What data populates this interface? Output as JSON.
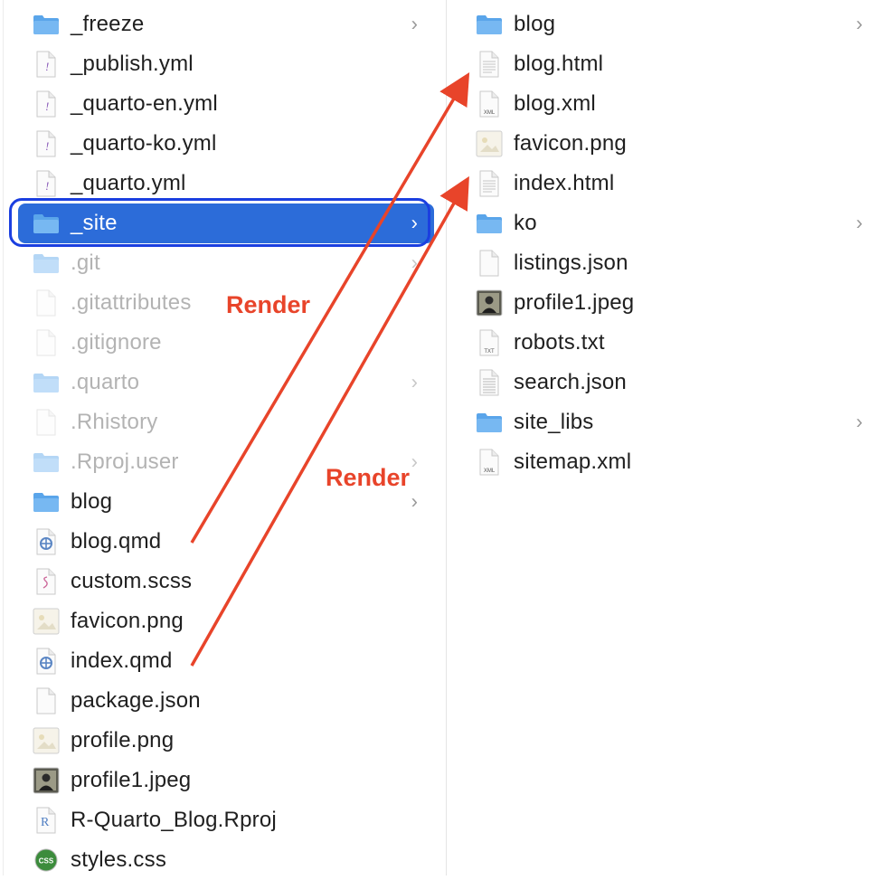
{
  "left_column": {
    "items": [
      {
        "label": "_freeze",
        "icon": "folder-icon",
        "chevron": true,
        "dim": false
      },
      {
        "label": "_publish.yml",
        "icon": "yaml-file-icon",
        "chevron": false,
        "dim": false
      },
      {
        "label": "_quarto-en.yml",
        "icon": "yaml-file-icon",
        "chevron": false,
        "dim": false
      },
      {
        "label": "_quarto-ko.yml",
        "icon": "yaml-file-icon",
        "chevron": false,
        "dim": false
      },
      {
        "label": "_quarto.yml",
        "icon": "yaml-file-icon",
        "chevron": false,
        "dim": false
      },
      {
        "label": "_site",
        "icon": "folder-icon",
        "chevron": true,
        "dim": false,
        "selected": true
      },
      {
        "label": ".git",
        "icon": "folder-icon",
        "chevron": true,
        "dim": true
      },
      {
        "label": ".gitattributes",
        "icon": "blank-file-icon",
        "chevron": false,
        "dim": true
      },
      {
        "label": ".gitignore",
        "icon": "blank-file-icon",
        "chevron": false,
        "dim": true
      },
      {
        "label": ".quarto",
        "icon": "folder-icon",
        "chevron": true,
        "dim": true
      },
      {
        "label": ".Rhistory",
        "icon": "blank-file-icon",
        "chevron": false,
        "dim": true
      },
      {
        "label": ".Rproj.user",
        "icon": "folder-icon",
        "chevron": true,
        "dim": true
      },
      {
        "label": "blog",
        "icon": "folder-icon",
        "chevron": true,
        "dim": false
      },
      {
        "label": "blog.qmd",
        "icon": "quarto-file-icon",
        "chevron": false,
        "dim": false
      },
      {
        "label": "custom.scss",
        "icon": "scss-file-icon",
        "chevron": false,
        "dim": false
      },
      {
        "label": "favicon.png",
        "icon": "image-file-icon",
        "chevron": false,
        "dim": false
      },
      {
        "label": "index.qmd",
        "icon": "quarto-file-icon",
        "chevron": false,
        "dim": false
      },
      {
        "label": "package.json",
        "icon": "blank-file-icon",
        "chevron": false,
        "dim": false
      },
      {
        "label": "profile.png",
        "icon": "image-file-icon",
        "chevron": false,
        "dim": false
      },
      {
        "label": "profile1.jpeg",
        "icon": "photo-file-icon",
        "chevron": false,
        "dim": false
      },
      {
        "label": "R-Quarto_Blog.Rproj",
        "icon": "rproj-file-icon",
        "chevron": false,
        "dim": false
      },
      {
        "label": "styles.css",
        "icon": "css-file-icon",
        "chevron": false,
        "dim": false
      }
    ]
  },
  "right_column": {
    "items": [
      {
        "label": "blog",
        "icon": "folder-icon",
        "chevron": true
      },
      {
        "label": "blog.html",
        "icon": "html-file-icon",
        "chevron": false
      },
      {
        "label": "blog.xml",
        "icon": "xml-file-icon",
        "chevron": false
      },
      {
        "label": "favicon.png",
        "icon": "image-file-icon",
        "chevron": false
      },
      {
        "label": "index.html",
        "icon": "html-file-icon",
        "chevron": false
      },
      {
        "label": "ko",
        "icon": "folder-icon",
        "chevron": true
      },
      {
        "label": "listings.json",
        "icon": "blank-file-icon",
        "chevron": false
      },
      {
        "label": "profile1.jpeg",
        "icon": "photo-file-icon",
        "chevron": false
      },
      {
        "label": "robots.txt",
        "icon": "txt-file-icon",
        "chevron": false
      },
      {
        "label": "search.json",
        "icon": "text-file-icon",
        "chevron": false
      },
      {
        "label": "site_libs",
        "icon": "folder-icon",
        "chevron": true
      },
      {
        "label": "sitemap.xml",
        "icon": "xml-file-icon",
        "chevron": false
      }
    ]
  },
  "annotations": {
    "render_1": "Render",
    "render_2": "Render",
    "color": "#e8442a"
  },
  "icon_badges": {
    "xml": "XML",
    "txt": "TXT",
    "css": "CSS"
  },
  "chevron_glyph": "›",
  "colors": {
    "selection": "#2c6cd9",
    "selection_outline": "#1b3fe0",
    "folder": "#5aa5ea"
  }
}
